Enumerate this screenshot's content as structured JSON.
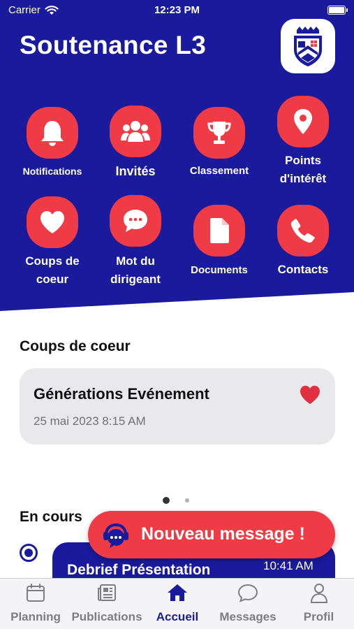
{
  "status_bar": {
    "carrier": "Carrier",
    "time": "12:23 PM"
  },
  "header": {
    "title": "Soutenance L3"
  },
  "tiles": [
    {
      "label": "Notifications",
      "icon": "bell-icon"
    },
    {
      "label": "Invités",
      "icon": "group-icon"
    },
    {
      "label": "Classement",
      "icon": "trophy-icon"
    },
    {
      "label": "Points\nd'intérêt",
      "icon": "location-pin-icon"
    },
    {
      "label": "Coups de\ncoeur",
      "icon": "heart-icon"
    },
    {
      "label": "Mot du\ndirigeant",
      "icon": "chat-bubble-icon"
    },
    {
      "label": "Documents",
      "icon": "document-icon"
    },
    {
      "label": "Contacts",
      "icon": "phone-icon"
    }
  ],
  "favorites": {
    "title": "Coups de coeur",
    "card": {
      "title": "Générations Evénement",
      "date": "25 mai 2023 8:15 AM"
    }
  },
  "en_cours": {
    "title": "En cours",
    "event": {
      "title": "Debrief Présentation",
      "time": "10:41 AM"
    }
  },
  "fab": {
    "label": "Nouveau message !"
  },
  "tabbar": {
    "active": "Accueil",
    "items": [
      {
        "label": "Planning",
        "icon": "calendar-icon"
      },
      {
        "label": "Publications",
        "icon": "newspaper-icon"
      },
      {
        "label": "Accueil",
        "icon": "home-icon"
      },
      {
        "label": "Messages",
        "icon": "chat-icon"
      },
      {
        "label": "Profil",
        "icon": "person-icon"
      }
    ]
  },
  "colors": {
    "primary": "#1a1a9c",
    "accent": "#ee3b46"
  }
}
